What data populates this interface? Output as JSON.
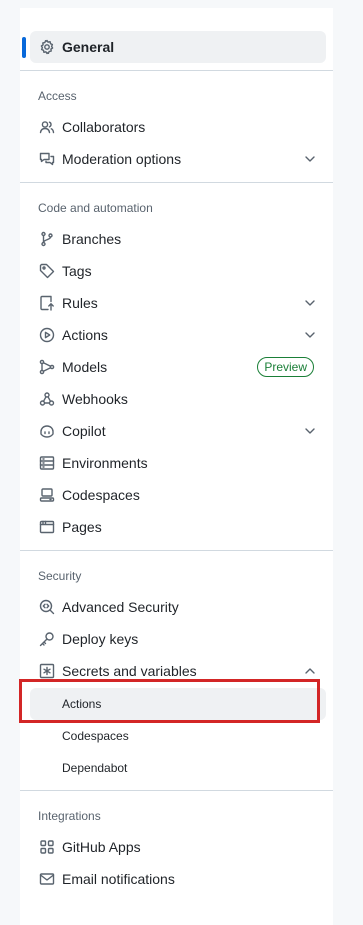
{
  "general": {
    "label": "General",
    "icon": "gear-icon"
  },
  "sections": {
    "access": {
      "title": "Access",
      "items": [
        {
          "label": "Collaborators",
          "icon": "people-icon"
        },
        {
          "label": "Moderation options",
          "icon": "comment-discussion-icon"
        }
      ]
    },
    "code": {
      "title": "Code and automation",
      "items": [
        {
          "label": "Branches",
          "icon": "git-branch-icon"
        },
        {
          "label": "Tags",
          "icon": "tag-icon"
        },
        {
          "label": "Rules",
          "icon": "repo-push-icon"
        },
        {
          "label": "Actions",
          "icon": "play-icon"
        },
        {
          "label": "Models",
          "icon": "ai-model-icon",
          "badge": "Preview"
        },
        {
          "label": "Webhooks",
          "icon": "webhook-icon"
        },
        {
          "label": "Copilot",
          "icon": "copilot-icon"
        },
        {
          "label": "Environments",
          "icon": "server-icon"
        },
        {
          "label": "Codespaces",
          "icon": "codespaces-icon"
        },
        {
          "label": "Pages",
          "icon": "browser-icon"
        }
      ]
    },
    "security": {
      "title": "Security",
      "items": [
        {
          "label": "Advanced Security",
          "icon": "codescan-icon"
        },
        {
          "label": "Deploy keys",
          "icon": "key-icon"
        },
        {
          "label": "Secrets and variables",
          "icon": "asterisk-icon"
        }
      ],
      "sub_items": [
        {
          "label": "Actions"
        },
        {
          "label": "Codespaces"
        },
        {
          "label": "Dependabot"
        }
      ]
    },
    "integrations": {
      "title": "Integrations",
      "items": [
        {
          "label": "GitHub Apps",
          "icon": "apps-icon"
        },
        {
          "label": "Email notifications",
          "icon": "mail-icon"
        }
      ]
    }
  },
  "colors": {
    "accent": "#0969da",
    "highlight": "#d32626",
    "badge": "#1a7f37"
  }
}
